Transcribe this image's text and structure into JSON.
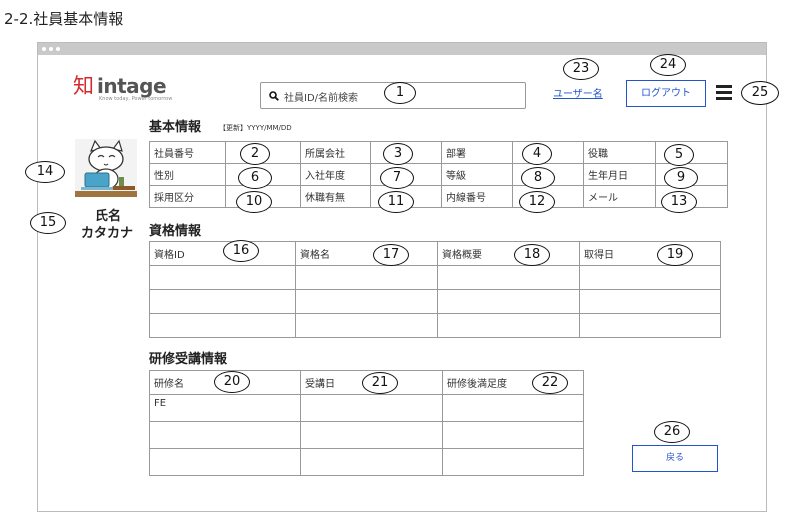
{
  "page_title": "2-2.社員基本情報",
  "logo": {
    "mark": "知",
    "name": "intage",
    "tagline": "Know today, Power tomorrow"
  },
  "header": {
    "search_placeholder": "社員ID/名前検索",
    "user_name": "ユーザー名",
    "logout_label": "ログアウト"
  },
  "employee": {
    "name": "氏名",
    "kana": "カタカナ"
  },
  "basic": {
    "title": "基本情報",
    "updated": "【更新】YYYY/MM/DD",
    "rows": [
      [
        "社員番号",
        "",
        "所属会社",
        "",
        "部署",
        "",
        "役職",
        ""
      ],
      [
        "性別",
        "",
        "入社年度",
        "",
        "等級",
        "",
        "生年月日",
        ""
      ],
      [
        "採用区分",
        "",
        "休職有無",
        "",
        "内線番号",
        "",
        "メール",
        ""
      ]
    ]
  },
  "qualifications": {
    "title": "資格情報",
    "headers": [
      "資格ID",
      "資格名",
      "資格概要",
      "取得日"
    ],
    "rows": [
      [
        "",
        "",
        "",
        ""
      ],
      [
        "",
        "",
        "",
        ""
      ],
      [
        "",
        "",
        "",
        ""
      ]
    ]
  },
  "training": {
    "title": "研修受講情報",
    "headers": [
      "研修名",
      "受講日",
      "研修後満足度"
    ],
    "rows": [
      [
        "FE",
        "",
        ""
      ],
      [
        "",
        "",
        ""
      ],
      [
        "",
        "",
        ""
      ]
    ]
  },
  "back_label": "戻る",
  "markers": [
    "1",
    "2",
    "3",
    "4",
    "5",
    "6",
    "7",
    "8",
    "9",
    "10",
    "11",
    "12",
    "13",
    "14",
    "15",
    "16",
    "17",
    "18",
    "19",
    "20",
    "21",
    "22",
    "23",
    "24",
    "25",
    "26"
  ]
}
